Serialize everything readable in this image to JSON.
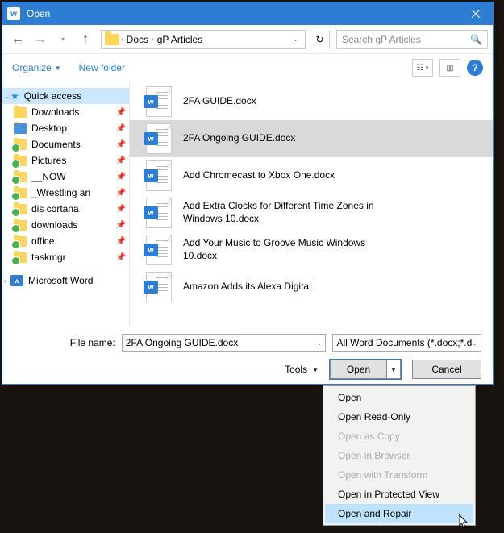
{
  "title": "Open",
  "breadcrumb": {
    "a": "Docs",
    "b": "gP Articles"
  },
  "search": {
    "placeholder": "Search gP Articles"
  },
  "toolbar": {
    "organize": "Organize",
    "newfolder": "New folder"
  },
  "sidebar": {
    "quick": "Quick access",
    "items": [
      {
        "label": "Downloads",
        "green": false
      },
      {
        "label": "Desktop",
        "green": false
      },
      {
        "label": "Documents",
        "green": true
      },
      {
        "label": "Pictures",
        "green": true
      },
      {
        "label": "__NOW",
        "green": true
      },
      {
        "label": "_Wrestling an",
        "green": true
      },
      {
        "label": "dis cortana",
        "green": true
      },
      {
        "label": "downloads",
        "green": true
      },
      {
        "label": "office",
        "green": true
      },
      {
        "label": "taskmgr",
        "green": true
      }
    ],
    "word": "Microsoft Word"
  },
  "files": [
    "2FA GUIDE.docx",
    "2FA Ongoing GUIDE.docx",
    "Add Chromecast to Xbox One.docx",
    "Add Extra Clocks for Different Time Zones in Windows 10.docx",
    "Add Your Music to Groove Music Windows 10.docx",
    "Amazon Adds its Alexa Digital"
  ],
  "selected_index": 1,
  "filename_label": "File name:",
  "filename_value": "2FA Ongoing GUIDE.docx",
  "filter": "All Word Documents (*.docx;*.d",
  "tools": "Tools",
  "open": "Open",
  "cancel": "Cancel",
  "menu": [
    {
      "label": "Open",
      "disabled": false
    },
    {
      "label": "Open Read-Only",
      "disabled": false
    },
    {
      "label": "Open as Copy",
      "disabled": true
    },
    {
      "label": "Open in Browser",
      "disabled": true
    },
    {
      "label": "Open with Transform",
      "disabled": true
    },
    {
      "label": "Open in Protected View",
      "disabled": false
    },
    {
      "label": "Open and Repair",
      "disabled": false
    }
  ],
  "menu_hover_index": 6
}
